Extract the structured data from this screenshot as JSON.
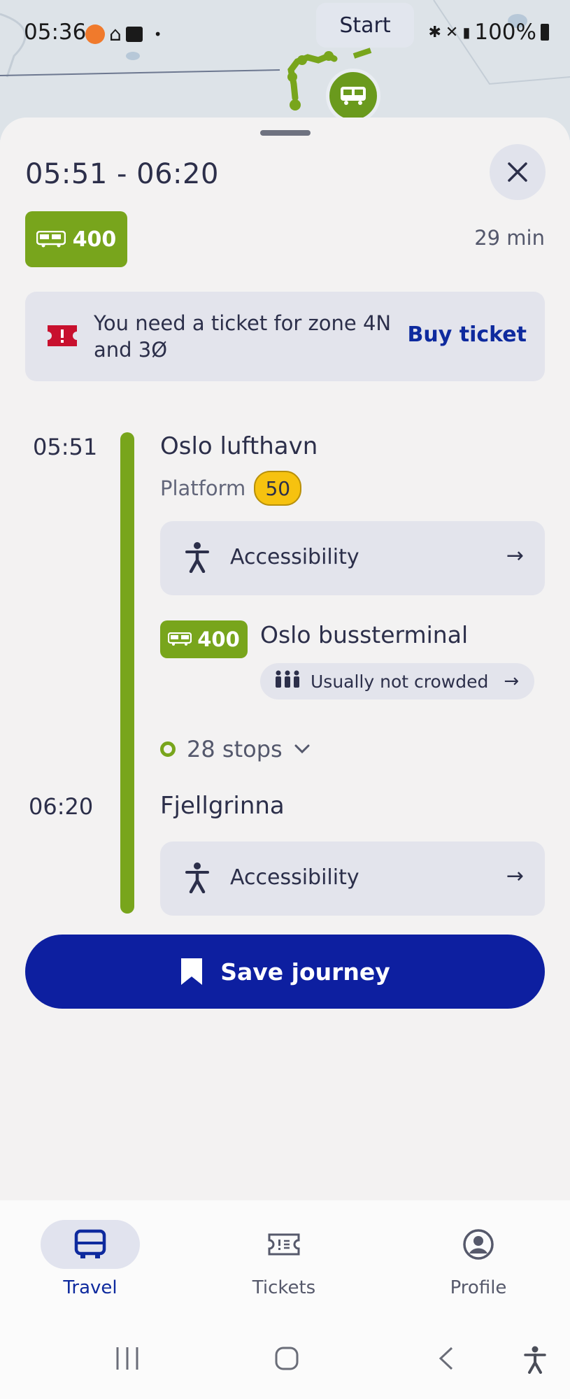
{
  "status_bar": {
    "time": "05:36",
    "battery": "100%"
  },
  "map": {
    "chip_label": "Start"
  },
  "trip": {
    "time_range": "05:51 - 06:20",
    "line": "400",
    "duration": "29 min"
  },
  "ticket_notice": {
    "text": "You need a ticket for zone 4N and 3Ø",
    "action": "Buy ticket"
  },
  "timeline": {
    "departure_time": "05:51",
    "departure_stop": "Oslo lufthavn",
    "platform_label": "Platform",
    "platform_number": "50",
    "accessibility_label": "Accessibility",
    "line": "400",
    "destination": "Oslo bussterminal",
    "crowding": "Usually not crowded",
    "stops_count": "28 stops",
    "arrival_time": "06:20",
    "arrival_stop": "Fjellgrinna",
    "arrow": "→"
  },
  "actions": {
    "save_journey": "Save journey"
  },
  "bottom_nav": {
    "items": [
      {
        "label": "Travel",
        "icon": "bus-icon",
        "active": true
      },
      {
        "label": "Tickets",
        "icon": "ticket-icon",
        "active": false
      },
      {
        "label": "Profile",
        "icon": "profile-icon",
        "active": false
      }
    ]
  },
  "colors": {
    "line_green": "#78a51c",
    "primary_blue": "#0d1fa0",
    "platform_yellow": "#f6c20f",
    "ticket_red": "#c8102e"
  }
}
